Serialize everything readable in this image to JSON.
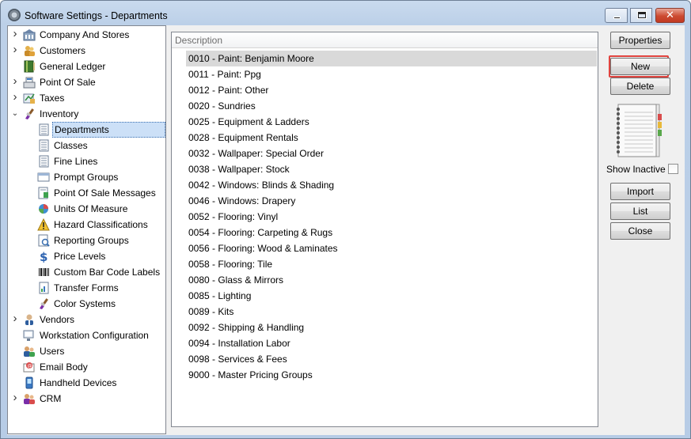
{
  "window": {
    "title": "Software Settings - Departments",
    "controls": {
      "minimize": "minimize",
      "maximize": "maximize",
      "close": "✕"
    }
  },
  "tree": [
    {
      "label": "Company And Stores",
      "icon": "building-icon",
      "expander": "›",
      "level": 0
    },
    {
      "label": "Customers",
      "icon": "people-icon",
      "expander": "›",
      "level": 0
    },
    {
      "label": "General Ledger",
      "icon": "ledger-book-icon",
      "expander": "",
      "level": 0
    },
    {
      "label": "Point Of Sale",
      "icon": "cash-register-icon",
      "expander": "›",
      "level": 0
    },
    {
      "label": "Taxes",
      "icon": "tax-icon",
      "expander": "›",
      "level": 0
    },
    {
      "label": "Inventory",
      "icon": "paintbrush-icon",
      "expander": "⌄",
      "level": 0
    },
    {
      "label": "Departments",
      "icon": "document-icon",
      "expander": "",
      "level": 1,
      "selected": true
    },
    {
      "label": "Classes",
      "icon": "document-icon",
      "expander": "",
      "level": 1
    },
    {
      "label": "Fine Lines",
      "icon": "document-icon",
      "expander": "",
      "level": 1
    },
    {
      "label": "Prompt Groups",
      "icon": "prompt-icon",
      "expander": "",
      "level": 1
    },
    {
      "label": "Point Of Sale Messages",
      "icon": "message-icon",
      "expander": "",
      "level": 1
    },
    {
      "label": "Units Of Measure",
      "icon": "units-icon",
      "expander": "",
      "level": 1
    },
    {
      "label": "Hazard Classifications",
      "icon": "warning-icon",
      "expander": "",
      "level": 1
    },
    {
      "label": "Reporting Groups",
      "icon": "report-icon",
      "expander": "",
      "level": 1
    },
    {
      "label": "Price Levels",
      "icon": "dollar-icon",
      "expander": "",
      "level": 1
    },
    {
      "label": "Custom Bar Code Labels",
      "icon": "barcode-icon",
      "expander": "",
      "level": 1
    },
    {
      "label": "Transfer Forms",
      "icon": "transfer-form-icon",
      "expander": "",
      "level": 1
    },
    {
      "label": "Color Systems",
      "icon": "paintbrush-icon",
      "expander": "",
      "level": 1
    },
    {
      "label": "Vendors",
      "icon": "vendor-icon",
      "expander": "›",
      "level": 0
    },
    {
      "label": "Workstation Configuration",
      "icon": "workstation-icon",
      "expander": "",
      "level": 0
    },
    {
      "label": "Users",
      "icon": "users-icon",
      "expander": "",
      "level": 0
    },
    {
      "label": "Email Body",
      "icon": "email-icon",
      "expander": "",
      "level": 0
    },
    {
      "label": "Handheld Devices",
      "icon": "handheld-icon",
      "expander": "",
      "level": 0
    },
    {
      "label": "CRM",
      "icon": "crm-icon",
      "expander": "›",
      "level": 0
    }
  ],
  "list": {
    "header": "Description",
    "rows": [
      "0010 - Paint:  Benjamin Moore",
      "0011 - Paint:  Ppg",
      "0012 - Paint:  Other",
      "0020 - Sundries",
      "0025 - Equipment & Ladders",
      "0028 - Equipment Rentals",
      "0032 - Wallpaper:  Special Order",
      "0038 - Wallpaper:  Stock",
      "0042 - Windows: Blinds & Shading",
      "0046 - Windows: Drapery",
      "0052 - Flooring:  Vinyl",
      "0054 - Flooring:  Carpeting & Rugs",
      "0056 - Flooring:  Wood & Laminates",
      "0058 - Flooring:  Tile",
      "0080 - Glass & Mirrors",
      "0085 - Lighting",
      "0089 - Kits",
      "0092 - Shipping & Handling",
      "0094 - Installation Labor",
      "0098 - Services & Fees",
      "9000 - Master Pricing Groups"
    ]
  },
  "buttons": {
    "properties": "Properties",
    "new": "New",
    "delete": "Delete",
    "show_inactive": "Show Inactive",
    "import": "Import",
    "list": "List",
    "close": "Close"
  },
  "colors": {
    "accent_highlight": "#e0443f",
    "selection": "#cce0f7",
    "list_selection": "#d9d9d9"
  }
}
